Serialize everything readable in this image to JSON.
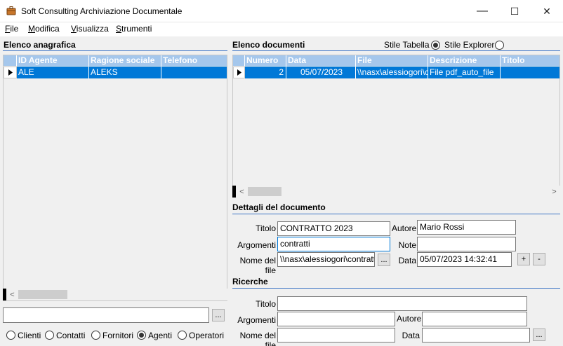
{
  "window": {
    "title": "Soft Consulting Archiviazione Documentale",
    "minimize_glyph": "—",
    "maximize_glyph": "☐",
    "close_glyph": "✕"
  },
  "menu": [
    {
      "label_first": "F",
      "label_rest": "ile"
    },
    {
      "label_first": "M",
      "label_rest": "odifica"
    },
    {
      "label_first": "V",
      "label_rest": "isualizza"
    },
    {
      "label_first": "S",
      "label_rest": "trumenti"
    }
  ],
  "anagrafica": {
    "title": "Elenco anagrafica",
    "columns": [
      "ID Agente",
      "Ragione sociale",
      "Telefono"
    ],
    "rows": [
      [
        "ALE",
        "ALEKS",
        ""
      ]
    ],
    "search_value": "",
    "search_button": "...",
    "filters": [
      {
        "label": "Clienti",
        "selected": false
      },
      {
        "label": "Contatti",
        "selected": false
      },
      {
        "label": "Fornitori",
        "selected": false
      },
      {
        "label": "Agenti",
        "selected": true
      },
      {
        "label": "Operatori",
        "selected": false
      }
    ]
  },
  "documenti": {
    "title": "Elenco documenti",
    "style_table_label": "Stile Tabella",
    "style_explorer_label": "Stile Explorer",
    "style_selected": "Stile Tabella",
    "columns": [
      "Numero",
      "Data",
      "File",
      "Descrizione",
      "Titolo"
    ],
    "rows": [
      [
        "2",
        "05/07/2023",
        "\\\\nasx\\alessiogori\\c",
        "File pdf_auto_file",
        ""
      ]
    ]
  },
  "dettagli": {
    "title": "Dettagli del documento",
    "titolo_label": "Titolo",
    "titolo_value": "CONTRATTO 2023",
    "autore_label": "Autore",
    "autore_value": "Mario Rossi",
    "argomenti_label": "Argomenti",
    "argomenti_value": "contratti",
    "note_label": "Note",
    "note_value": "",
    "nomefile_label": "Nome del file",
    "nomefile_value": "\\\\nasx\\alessiogori\\contratti\\",
    "browse_button": "...",
    "data_label": "Data",
    "data_value": "05/07/2023 14:32:41",
    "plus_button": "+",
    "minus_button": "-"
  },
  "ricerche": {
    "title": "Ricerche",
    "titolo_label": "Titolo",
    "titolo_value": "",
    "argomenti_label": "Argomenti",
    "argomenti_value": "",
    "autore_label": "Autore",
    "autore_value": "",
    "nomefile_label": "Nome del file",
    "nomefile_value": "",
    "data_label": "Data",
    "data_value": "",
    "browse_button": "..."
  },
  "scroll": {
    "left_arrow": "<",
    "right_arrow": ">"
  }
}
